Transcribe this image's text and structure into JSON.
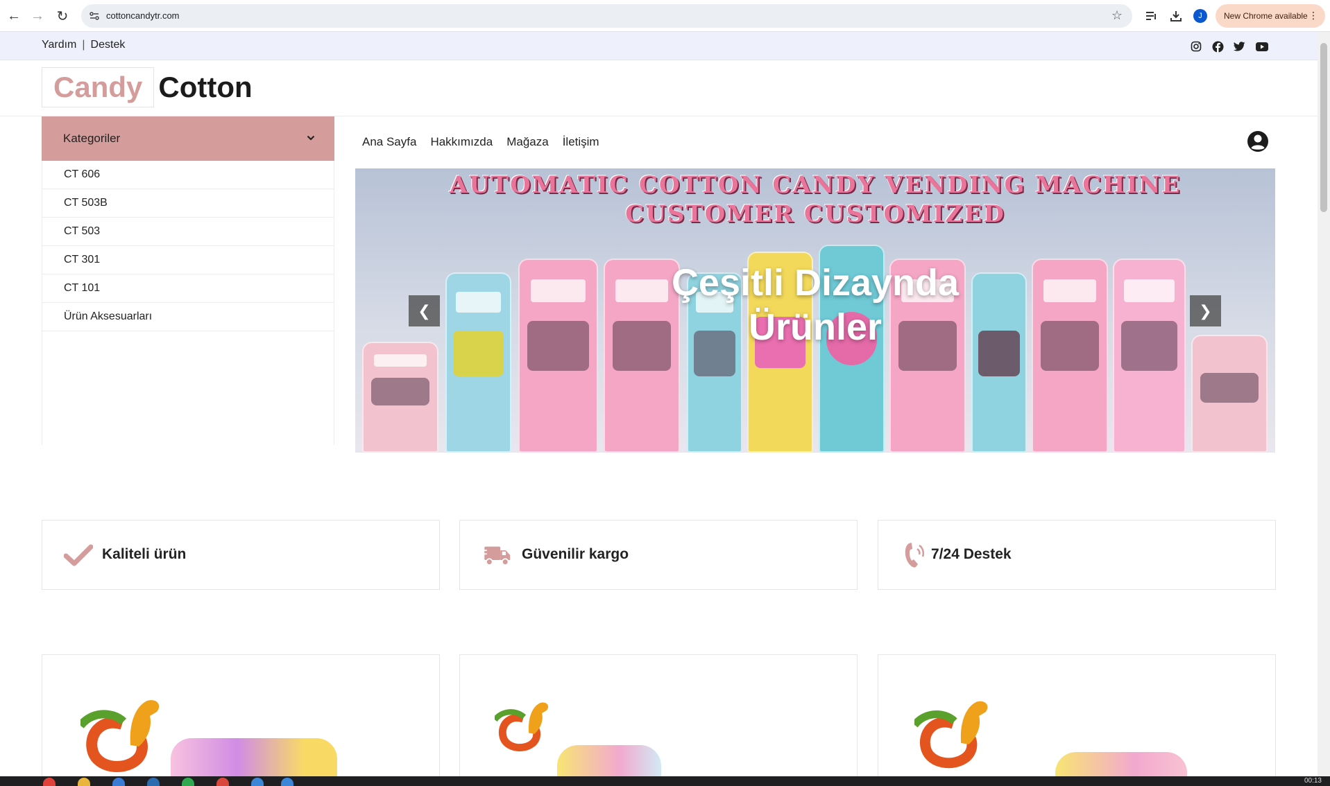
{
  "browser": {
    "url": "cottoncandytr.com",
    "update_label": "New Chrome available",
    "profile_initial": "J"
  },
  "topbar": {
    "help": "Yardım",
    "separator": "|",
    "support": "Destek",
    "social_icons": [
      "instagram-icon",
      "facebook-icon",
      "twitter-icon",
      "youtube-icon"
    ]
  },
  "logo": {
    "word1": "Candy",
    "word2": "Cotton"
  },
  "categories": {
    "title": "Kategoriler",
    "items": [
      "CT 606",
      "CT 503B",
      "CT 503",
      "CT 301",
      "CT 101",
      "Ürün Aksesuarları"
    ]
  },
  "nav": {
    "items": [
      "Ana Sayfa",
      "Hakkımızda",
      "Mağaza",
      "İletişim"
    ]
  },
  "hero": {
    "banner_line1": "AUTOMATIC COTTON CANDY VENDING MACHINE",
    "banner_line2": "CUSTOMER CUSTOMIZED",
    "caption_line1": "Çeşitli Dizaynda",
    "caption_line2": "Ürünler"
  },
  "features": [
    {
      "icon": "check-icon",
      "label": "Kaliteli ürün"
    },
    {
      "icon": "truck-icon",
      "label": "Güvenilir kargo"
    },
    {
      "icon": "phone-icon",
      "label": "7/24 Destek"
    }
  ],
  "colors": {
    "accent": "#d49c9a",
    "topbar_bg": "#eef1fb"
  },
  "taskbar": {
    "clock": "00:13"
  }
}
